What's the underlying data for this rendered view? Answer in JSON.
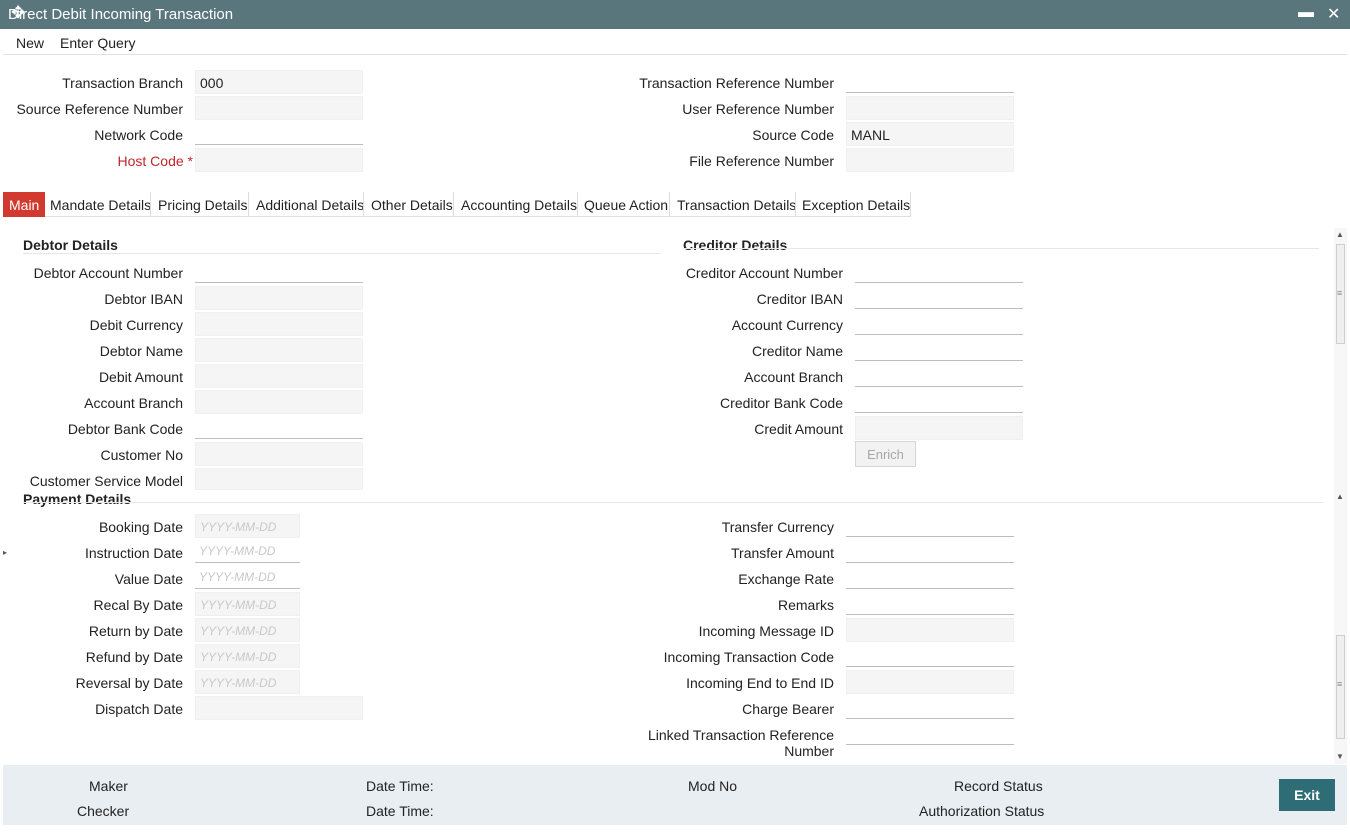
{
  "window": {
    "title": "Direct Debit Incoming Transaction",
    "cursor_icon": "move-cursor-icon",
    "minimize_icon": "minimize-icon",
    "close_icon": "close-icon"
  },
  "toolbar": {
    "new": "New",
    "enter_query": "Enter Query"
  },
  "header": {
    "transaction_branch": {
      "label": "Transaction Branch",
      "value": "000"
    },
    "source_reference_number": {
      "label": "Source Reference Number",
      "value": ""
    },
    "network_code": {
      "label": "Network Code",
      "value": ""
    },
    "host_code": {
      "label": "Host Code",
      "required_mark": "*",
      "value": ""
    },
    "transaction_reference_number": {
      "label": "Transaction Reference Number",
      "value": ""
    },
    "user_reference_number": {
      "label": "User Reference Number",
      "value": ""
    },
    "source_code": {
      "label": "Source Code",
      "value": "MANL"
    },
    "file_reference_number": {
      "label": "File Reference Number",
      "value": ""
    }
  },
  "tabs": [
    {
      "label": "Main",
      "active": true
    },
    {
      "label": "Mandate Details",
      "active": false
    },
    {
      "label": "Pricing Details",
      "active": false
    },
    {
      "label": "Additional Details",
      "active": false
    },
    {
      "label": "Other Details",
      "active": false
    },
    {
      "label": "Accounting Details",
      "active": false
    },
    {
      "label": "Queue Action",
      "active": false
    },
    {
      "label": "Transaction Details",
      "active": false
    },
    {
      "label": "Exception Details",
      "active": false
    }
  ],
  "debtor": {
    "title": "Debtor Details",
    "fields": [
      {
        "label": "Debtor Account Number",
        "value": ""
      },
      {
        "label": "Debtor IBAN",
        "value": ""
      },
      {
        "label": "Debit Currency",
        "value": ""
      },
      {
        "label": "Debtor Name",
        "value": ""
      },
      {
        "label": "Debit Amount",
        "value": ""
      },
      {
        "label": "Account Branch",
        "value": ""
      },
      {
        "label": "Debtor Bank Code",
        "value": ""
      },
      {
        "label": "Customer No",
        "value": ""
      },
      {
        "label": "Customer Service Model",
        "value": ""
      }
    ]
  },
  "creditor": {
    "title": "Creditor Details",
    "fields": [
      {
        "label": "Creditor Account Number",
        "value": ""
      },
      {
        "label": "Creditor IBAN",
        "value": ""
      },
      {
        "label": "Account Currency",
        "value": ""
      },
      {
        "label": "Creditor Name",
        "value": ""
      },
      {
        "label": "Account Branch",
        "value": ""
      },
      {
        "label": "Creditor Bank Code",
        "value": ""
      },
      {
        "label": "Credit Amount",
        "value": ""
      }
    ],
    "enrich_button": "Enrich"
  },
  "payment": {
    "title": "Payment Details",
    "date_placeholder": "YYYY-MM-DD",
    "left_fields": [
      {
        "label": "Booking Date",
        "value": ""
      },
      {
        "label": "Instruction Date",
        "value": ""
      },
      {
        "label": "Value Date",
        "value": ""
      },
      {
        "label": "Recal By Date",
        "value": ""
      },
      {
        "label": "Return by Date",
        "value": ""
      },
      {
        "label": "Refund by Date",
        "value": ""
      },
      {
        "label": "Reversal by Date",
        "value": ""
      },
      {
        "label": "Dispatch Date",
        "value": ""
      }
    ],
    "right_fields": [
      {
        "label": "Transfer Currency",
        "value": ""
      },
      {
        "label": "Transfer Amount",
        "value": ""
      },
      {
        "label": "Exchange Rate",
        "value": ""
      },
      {
        "label": "Remarks",
        "value": ""
      },
      {
        "label": "Incoming Message ID",
        "value": ""
      },
      {
        "label": "Incoming Transaction Code",
        "value": ""
      },
      {
        "label": "Incoming End to End ID",
        "value": ""
      },
      {
        "label": "Charge Bearer",
        "value": ""
      },
      {
        "label": "Linked Transaction Reference",
        "label_line2": "Number",
        "value": ""
      }
    ]
  },
  "footer": {
    "maker": "Maker",
    "checker": "Checker",
    "date_time_1": "Date Time:",
    "date_time_2": "Date Time:",
    "mod_no": "Mod No",
    "record_status": "Record Status",
    "authorization_status": "Authorization Status",
    "exit": "Exit"
  },
  "colors": {
    "titlebar": "#5a767d",
    "active_tab": "#d23a30",
    "required": "#c0262b",
    "footer_bg": "#e8eef1",
    "exit_button": "#2e6c76"
  }
}
